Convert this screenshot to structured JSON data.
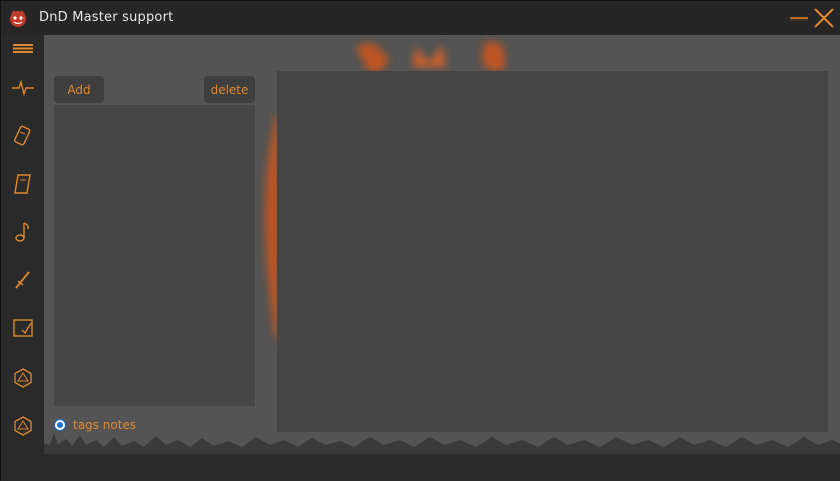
{
  "window": {
    "title": "DnD Master support",
    "accent": "#e0872e"
  },
  "sidebar": {
    "items": [
      {
        "icon": "menu-icon"
      },
      {
        "icon": "heartbeat-icon"
      },
      {
        "icon": "dice-icon"
      },
      {
        "icon": "scroll-icon"
      },
      {
        "icon": "music-note-icon"
      },
      {
        "icon": "dagger-icon"
      },
      {
        "icon": "notes-check-icon"
      },
      {
        "icon": "d20-icon"
      },
      {
        "icon": "d20-icon"
      }
    ]
  },
  "toolbar": {
    "add_label": "Add",
    "delete_label": "delete"
  },
  "options": {
    "tags_notes_label": "tags notes",
    "tags_notes_checked": true
  }
}
